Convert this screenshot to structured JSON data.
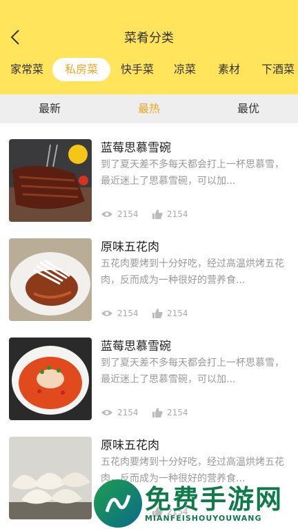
{
  "header": {
    "title": "菜肴分类"
  },
  "categories": [
    {
      "label": "家常菜",
      "active": false
    },
    {
      "label": "私房菜",
      "active": true
    },
    {
      "label": "快手菜",
      "active": false
    },
    {
      "label": "凉菜",
      "active": false
    },
    {
      "label": "素材",
      "active": false
    },
    {
      "label": "下酒菜",
      "active": false
    }
  ],
  "sort_tabs": [
    {
      "label": "最新",
      "active": false
    },
    {
      "label": "最热",
      "active": true
    },
    {
      "label": "最优",
      "active": false
    }
  ],
  "colors": {
    "header_bg": "#FFE45C",
    "accent": "#F5A623",
    "sort_bg": "#EEEEEE"
  },
  "recipes": [
    {
      "title": "蓝莓思慕雪碗",
      "desc": "到了夏天差不多每天都会打上一杯思慕雪，最近迷上了思慕雪碗，可以加...",
      "views": "2154",
      "likes": "2154",
      "image": "grilled-ribs"
    },
    {
      "title": "原味五花肉",
      "desc": "五花肉要烤到十分好吃，经过高温烘烤五花肉，反而成为一种很好的营养食...",
      "views": "2154",
      "likes": "2154",
      "image": "shredded-pork-plate"
    },
    {
      "title": "蓝莓思慕雪碗",
      "desc": "到了夏天差不多每天都会打上一杯思慕雪，最近迷上了思慕雪碗，可以加...",
      "views": "2154",
      "likes": "2154",
      "image": "spicy-fish-soup"
    },
    {
      "title": "原味五花肉",
      "desc": "五花肉要烤到十分好吃，经过高温烘烤五花肉，反而成为一种很好的营养食...",
      "views": "2154",
      "likes": "2154",
      "image": "dumplings"
    }
  ],
  "watermark": {
    "text": "免费手游网",
    "sub": "MIANFEISHOUYOUWANG"
  }
}
